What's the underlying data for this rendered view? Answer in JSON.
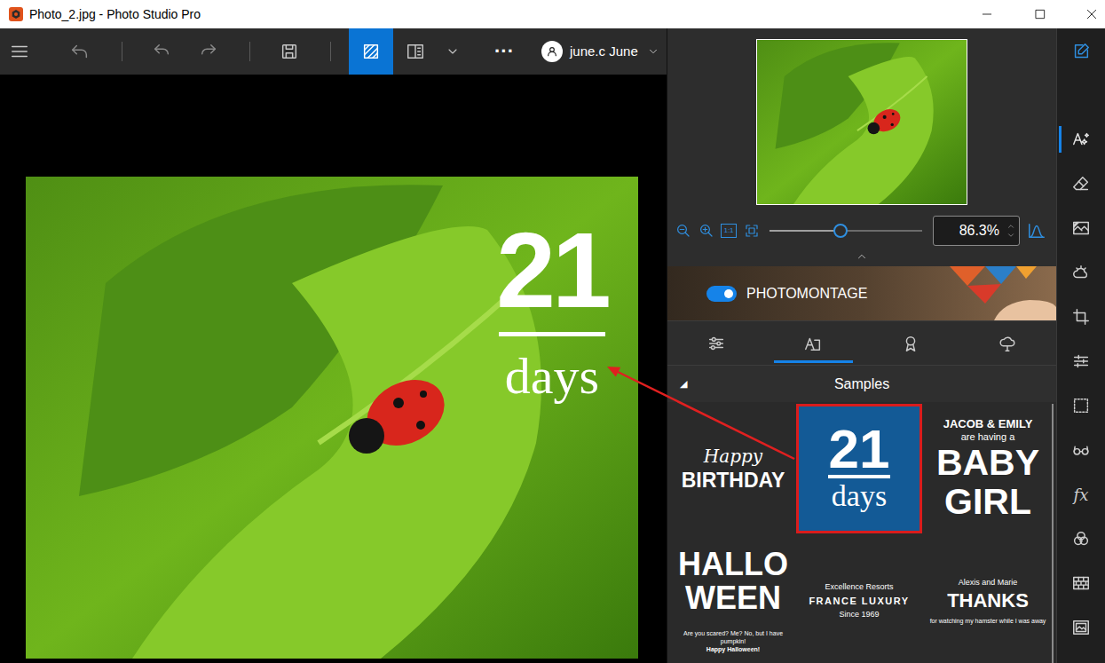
{
  "window": {
    "title": "Photo_2.jpg - Photo Studio Pro"
  },
  "toolbar": {
    "view_modes": [
      {
        "selected": true
      },
      {
        "selected": false
      }
    ],
    "more": "···",
    "user": "june.c June"
  },
  "canvas": {
    "text_layer": {
      "number": "21",
      "word": "days"
    }
  },
  "navigator": {
    "zoom": "86.3%",
    "level": 0.465,
    "actual_size": "1:1"
  },
  "photomontage": {
    "label": "PHOTOMONTAGE",
    "on": true
  },
  "panel_tabs": [
    {
      "selected": false
    },
    {
      "selected": true
    },
    {
      "selected": false
    },
    {
      "selected": false
    }
  ],
  "samples": {
    "toggle": "◢",
    "title": "Samples",
    "expanded": true,
    "items": [
      {
        "selected": false,
        "lines": [
          {
            "text": "Happy",
            "kind": "script"
          },
          {
            "text": "BIRTHDAY",
            "kind": "caps-m"
          }
        ]
      },
      {
        "selected": true,
        "lines": [
          {
            "text": "21",
            "kind": "number"
          },
          {
            "text": "days",
            "kind": "serif-word"
          }
        ]
      },
      {
        "selected": false,
        "lines": [
          {
            "text": "JACOB & EMILY",
            "kind": "caps-s"
          },
          {
            "text": "are having a",
            "kind": "small"
          },
          {
            "text": "BABY",
            "kind": "caps-xl"
          },
          {
            "text": "GIRL",
            "kind": "caps-xl"
          }
        ]
      },
      {
        "selected": false,
        "lines": [
          {
            "text": "HALLO",
            "kind": "caps-l"
          },
          {
            "text": "WEEN",
            "kind": "caps-l"
          },
          {
            "text": "Are you scared? Me? No, but I have pumpkin!",
            "kind": "tiny-gap"
          },
          {
            "text": "Happy Halloween!",
            "kind": "tiny-bold"
          }
        ]
      },
      {
        "selected": false,
        "lines": [
          {
            "text": "Excellence Resorts",
            "kind": "caption"
          },
          {
            "text": "FRANCE LUXURY",
            "kind": "spaced"
          },
          {
            "text": "Since 1969",
            "kind": "caption"
          }
        ]
      },
      {
        "selected": false,
        "lines": [
          {
            "text": "Alexis and Marie",
            "kind": "caption"
          },
          {
            "text": "THANKS",
            "kind": "caps-t"
          },
          {
            "text": "for watching my hamster while I was away",
            "kind": "tiny"
          }
        ]
      }
    ]
  },
  "sidebar": {
    "edit_selected": true,
    "items": [
      {
        "selected": true
      },
      {
        "selected": false
      },
      {
        "selected": false
      },
      {
        "selected": false
      },
      {
        "selected": false
      },
      {
        "selected": false
      },
      {
        "selected": false
      },
      {
        "selected": false
      },
      {
        "selected": false,
        "glyph": "fx"
      },
      {
        "selected": false
      },
      {
        "selected": false
      },
      {
        "selected": false
      }
    ]
  }
}
